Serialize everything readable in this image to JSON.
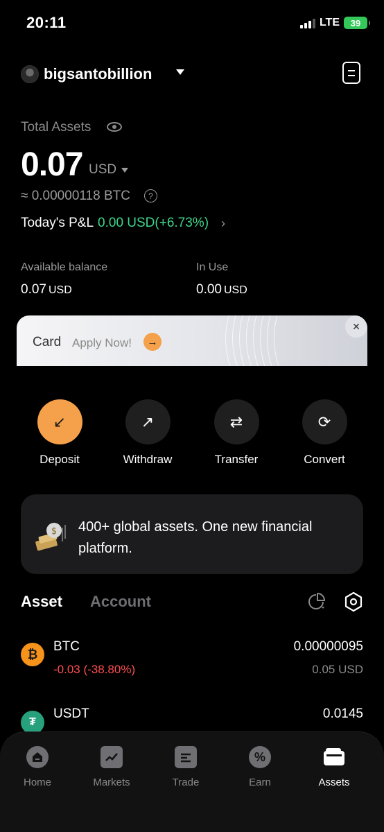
{
  "status_bar": {
    "time": "20:11",
    "network": "LTE",
    "battery": "39"
  },
  "header": {
    "username": "bigsantobillion"
  },
  "total_assets": {
    "label": "Total Assets",
    "value": "0.07",
    "unit": "USD",
    "btc_equivalent": "≈ 0.00000118 BTC",
    "pnl_label": "Today's P&L",
    "pnl_value": "0.00 USD(+6.73%)"
  },
  "balances": {
    "available_label": "Available balance",
    "available_value": "0.07",
    "available_unit": "USD",
    "in_use_label": "In Use",
    "in_use_value": "0.00",
    "in_use_unit": "USD"
  },
  "card_banner": {
    "title": "Card",
    "cta": "Apply Now!"
  },
  "actions": [
    {
      "label": "Deposit",
      "icon": "arrow-down-left-icon"
    },
    {
      "label": "Withdraw",
      "icon": "arrow-up-right-icon"
    },
    {
      "label": "Transfer",
      "icon": "transfer-arrows-icon"
    },
    {
      "label": "Convert",
      "icon": "refresh-icon"
    }
  ],
  "promo": {
    "text": "400+ global assets. One new financial platform."
  },
  "tabs": {
    "active": "Asset",
    "inactive": "Account"
  },
  "assets": [
    {
      "symbol": "BTC",
      "change": "-0.03 (-38.80%)",
      "quantity": "0.00000095",
      "value": "0.05 USD"
    },
    {
      "symbol": "USDT",
      "change": "",
      "quantity": "0.0145",
      "value": ""
    }
  ],
  "bottom_nav": [
    {
      "label": "Home",
      "icon": "home-icon"
    },
    {
      "label": "Markets",
      "icon": "chart-icon"
    },
    {
      "label": "Trade",
      "icon": "trade-icon"
    },
    {
      "label": "Earn",
      "icon": "percent-icon"
    },
    {
      "label": "Assets",
      "icon": "wallet-icon"
    }
  ],
  "colors": {
    "accent": "#f5a04a",
    "positive": "#3dd68c",
    "negative": "#ff4d4f",
    "background": "#000000"
  }
}
